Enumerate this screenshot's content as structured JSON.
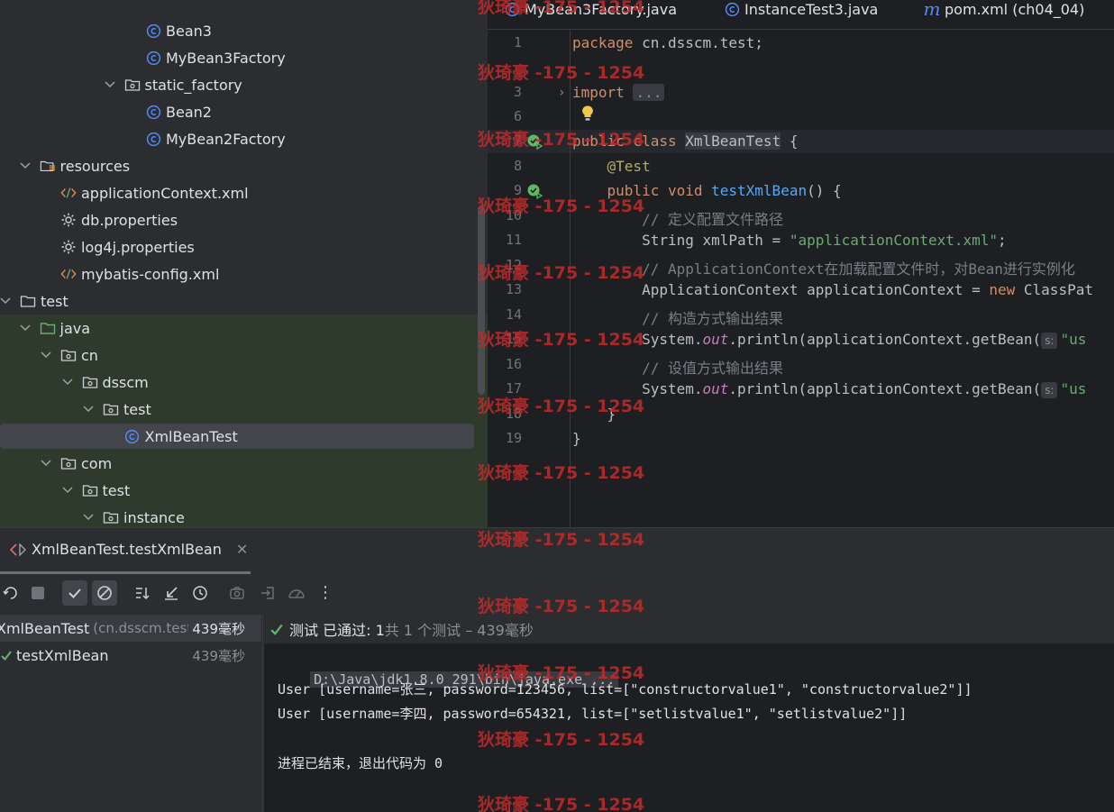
{
  "editor_tabs": [
    {
      "label": "MyBean3Factory.java",
      "icon": "class-icon"
    },
    {
      "label": "InstanceTest3.java",
      "icon": "class-icon"
    },
    {
      "label": "pom.xml (ch04_04)",
      "icon": "maven-icon"
    }
  ],
  "tree": {
    "items": [
      {
        "label": "Bean3",
        "icon": "class-icon",
        "depth": 6,
        "chevron": ""
      },
      {
        "label": "MyBean3Factory",
        "icon": "class-icon",
        "depth": 6,
        "chevron": ""
      },
      {
        "label": "static_factory",
        "icon": "package-icon",
        "depth": 5,
        "chevron": "down"
      },
      {
        "label": "Bean2",
        "icon": "class-icon",
        "depth": 6,
        "chevron": ""
      },
      {
        "label": "MyBean2Factory",
        "icon": "class-icon",
        "depth": 6,
        "chevron": ""
      },
      {
        "label": "resources",
        "icon": "resources-folder-icon",
        "depth": 1,
        "chevron": "down"
      },
      {
        "label": "applicationContext.xml",
        "icon": "xml-file-icon",
        "depth": 2,
        "chevron": ""
      },
      {
        "label": "db.properties",
        "icon": "properties-file-icon",
        "depth": 2,
        "chevron": ""
      },
      {
        "label": "log4j.properties",
        "icon": "properties-file-icon",
        "depth": 2,
        "chevron": ""
      },
      {
        "label": "mybatis-config.xml",
        "icon": "xml-file-icon",
        "depth": 2,
        "chevron": ""
      },
      {
        "label": "test",
        "icon": "folder-icon",
        "depth": 0,
        "chevron": "down"
      },
      {
        "label": "java",
        "icon": "test-source-folder-icon",
        "depth": 1,
        "chevron": "down"
      },
      {
        "label": "cn",
        "icon": "package-icon",
        "depth": 2,
        "chevron": "down"
      },
      {
        "label": "dsscm",
        "icon": "package-icon",
        "depth": 3,
        "chevron": "down"
      },
      {
        "label": "test",
        "icon": "package-icon",
        "depth": 4,
        "chevron": "down"
      },
      {
        "label": "XmlBeanTest",
        "icon": "class-icon",
        "depth": 5,
        "chevron": "",
        "selected": true
      },
      {
        "label": "com",
        "icon": "package-icon",
        "depth": 2,
        "chevron": "down"
      },
      {
        "label": "test",
        "icon": "package-icon",
        "depth": 3,
        "chevron": "down"
      },
      {
        "label": "instance",
        "icon": "package-icon",
        "depth": 4,
        "chevron": "down"
      }
    ]
  },
  "editor": {
    "lines": [
      {
        "n": "1",
        "tokens": [
          [
            "kw",
            "package "
          ],
          [
            "",
            "cn.dsscm.test;"
          ]
        ]
      },
      {
        "n": "3",
        "tokens": [
          [
            "kw",
            "import "
          ],
          [
            "fold",
            "..."
          ]
        ],
        "folded": true
      },
      {
        "n": "6",
        "tokens": [],
        "bulb": true
      },
      {
        "n": "7",
        "tokens": [
          [
            "kw",
            "public class "
          ],
          [
            "cls-hl",
            "XmlBeanTest"
          ],
          [
            "",
            " {"
          ]
        ],
        "run": true
      },
      {
        "n": "8",
        "tokens": [
          [
            "ann",
            "    @Test"
          ]
        ]
      },
      {
        "n": "9",
        "tokens": [
          [
            "kw",
            "    public void "
          ],
          [
            "fn",
            "testXmlBean"
          ],
          [
            "",
            "() {"
          ]
        ],
        "run": true
      },
      {
        "n": "10",
        "tokens": [
          [
            "cmt",
            "        // 定义配置文件路径"
          ]
        ]
      },
      {
        "n": "11",
        "tokens": [
          [
            "",
            "        String xmlPath = "
          ],
          [
            "str",
            "\"applicationContext.xml\""
          ],
          [
            "",
            ";"
          ]
        ]
      },
      {
        "n": "12",
        "tokens": [
          [
            "cmt",
            "        // ApplicationContext在加载配置文件时，对Bean进行实例化"
          ]
        ]
      },
      {
        "n": "13",
        "tokens": [
          [
            "",
            "        ApplicationContext applicationContext = "
          ],
          [
            "kw",
            "new "
          ],
          [
            "",
            "ClassPat"
          ]
        ]
      },
      {
        "n": "14",
        "tokens": [
          [
            "cmt",
            "        // 构造方式输出结果"
          ]
        ]
      },
      {
        "n": "15",
        "tokens": [
          [
            "",
            "        System."
          ],
          [
            "ital",
            "out"
          ],
          [
            "",
            ".println(applicationContext.getBean("
          ],
          [
            "hint",
            "s:"
          ],
          [
            "str",
            "\"us"
          ]
        ]
      },
      {
        "n": "16",
        "tokens": [
          [
            "cmt",
            "        // 设值方式输出结果"
          ]
        ]
      },
      {
        "n": "17",
        "tokens": [
          [
            "",
            "        System."
          ],
          [
            "ital",
            "out"
          ],
          [
            "",
            ".println(applicationContext.getBean("
          ],
          [
            "hint",
            "s:"
          ],
          [
            "str",
            "\"us"
          ]
        ]
      },
      {
        "n": "18",
        "tokens": [
          [
            "",
            "    }"
          ]
        ]
      },
      {
        "n": "19",
        "tokens": [
          [
            "",
            "}"
          ]
        ]
      }
    ]
  },
  "run": {
    "tab_label": "XmlBeanTest.testXmlBean",
    "status_label": "测试 已通过: 1",
    "status_detail": "共 1 个测试 – 439毫秒",
    "tests": [
      {
        "name": "XmlBeanTest",
        "package": "(cn.dsscm.test",
        "time": "439毫秒",
        "selected": true
      },
      {
        "name": "testXmlBean",
        "package": "",
        "time": "439毫秒",
        "selected": false
      }
    ],
    "console": {
      "command": "D:\\Java\\jdk1.8.0_291\\bin\\java.exe ...",
      "output_1": "User [username=张三, password=123456, list=[\"constructorvalue1\", \"constructorvalue2\"]]",
      "output_2": "User [username=李四, password=654321, list=[\"setlistvalue1\", \"setlistvalue2\"]]",
      "exit": "进程已结束，退出代码为 0"
    }
  },
  "watermark": "狄琦豪 -175 - 1254",
  "colors": {
    "accent_blue": "#548af7",
    "test_pass": "#5fb865",
    "watermark": "#c42a2a"
  }
}
